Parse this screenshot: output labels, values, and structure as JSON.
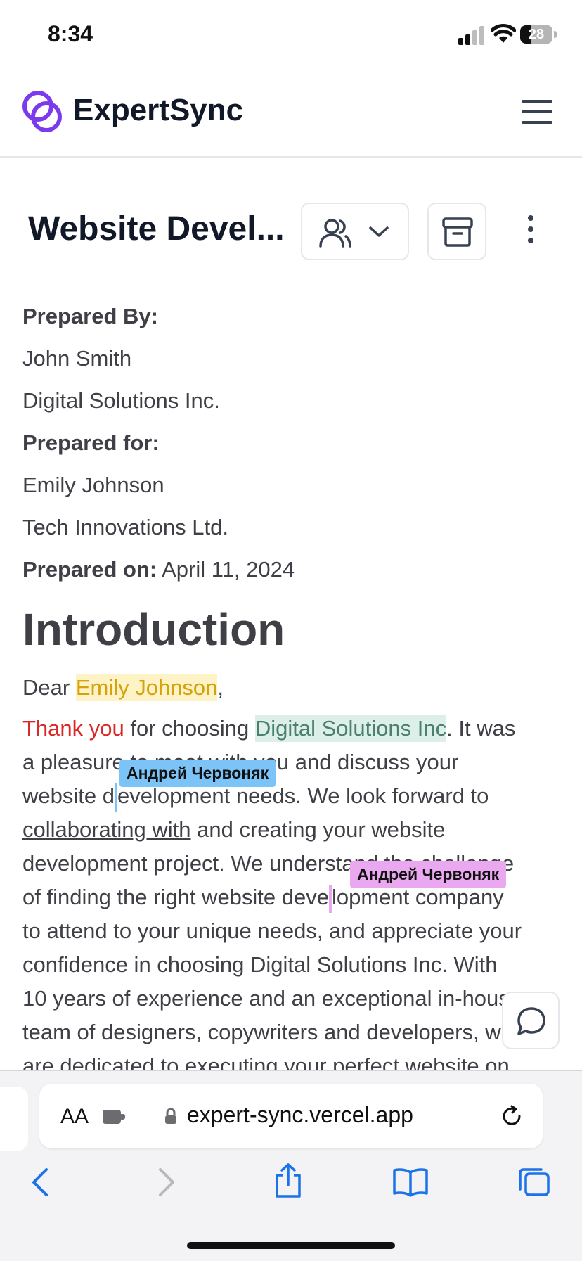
{
  "status_bar": {
    "time": "8:34",
    "battery": "28"
  },
  "header": {
    "brand": "ExpertSync"
  },
  "toolbar": {
    "title": "Website Devel..."
  },
  "document": {
    "prepared_by_label": "Prepared By:",
    "prepared_by_name": "John Smith",
    "prepared_by_company": "Digital Solutions Inc.",
    "prepared_for_label": "Prepared for:",
    "prepared_for_name": "Emily Johnson",
    "prepared_for_company": "Tech Innovations Ltd.",
    "prepared_on_label": "Prepared on:",
    "prepared_on_date": "April 11, 2024",
    "heading": "Introduction",
    "dear": "Dear ",
    "dear_name": "Emily Johnson",
    "dear_comma": ",",
    "line1_thank": "Thank you",
    "line1_mid": " for choosing ",
    "line1_company": "Digital Solutions Inc",
    "line1_end": ". It was",
    "line2": "a pleasure to meet with you and discuss your",
    "line3_a": "website d",
    "line3_b": "evelopment needs. We look forward to",
    "line4_link": "collaborating with",
    "line4_rest": " and creating your website",
    "line5": "development project. We understand the challenge",
    "line6_a": "of finding the right website deve",
    "line6_b": "lopment company",
    "line7": "to attend to your unique needs, and appreciate your",
    "line8": "confidence in choosing Digital Solutions Inc. With",
    "line9": "10 years of experience and an exceptional in-house",
    "line10": "team of designers, copywriters and developers, we",
    "line11": "are dedicated to executing your perfect website on"
  },
  "collaborators": {
    "cursor1_name": "Андрей Червоняк",
    "cursor1_color": "#7cc4f8",
    "cursor2_name": "Андрей Червоняк",
    "cursor2_color": "#eaa8f0"
  },
  "browser": {
    "aa_label": "AA",
    "url": "expert-sync.vercel.app"
  },
  "colors": {
    "brand_purple": "#7c3aed",
    "safari_blue": "#1a73e8"
  }
}
